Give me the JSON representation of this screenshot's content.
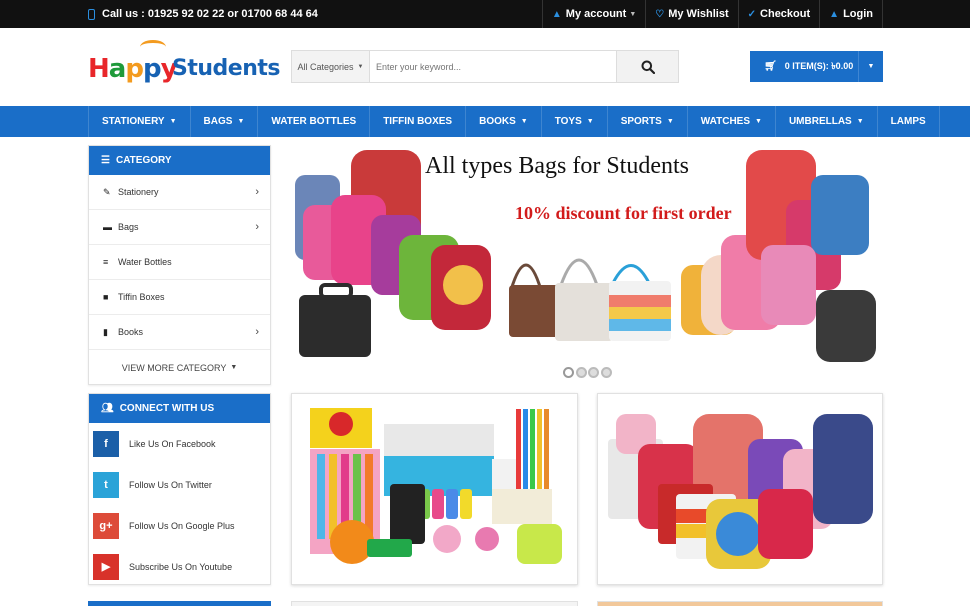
{
  "topbar": {
    "phone": "Call us : 01925 92 02 22 or 01700 68 44 64",
    "account": "My account",
    "wishlist": "My Wishlist",
    "checkout": "Checkout",
    "login": "Login"
  },
  "logo": {
    "word1": "Happy",
    "word2": "Students"
  },
  "search": {
    "category": "All Categories",
    "placeholder": "Enter your keyword..."
  },
  "cart": {
    "label": "0 ITEM(S): ৳0.00"
  },
  "nav": [
    {
      "label": "STATIONERY",
      "dropdown": true
    },
    {
      "label": "BAGS",
      "dropdown": true
    },
    {
      "label": "WATER BOTTLES",
      "dropdown": false
    },
    {
      "label": "TIFFIN BOXES",
      "dropdown": false
    },
    {
      "label": "BOOKS",
      "dropdown": true
    },
    {
      "label": "TOYS",
      "dropdown": true
    },
    {
      "label": "SPORTS",
      "dropdown": true
    },
    {
      "label": "WATCHES",
      "dropdown": true
    },
    {
      "label": "UMBRELLAS",
      "dropdown": true
    },
    {
      "label": "LAMPS",
      "dropdown": false
    }
  ],
  "category": {
    "heading": "CATEGORY",
    "items": [
      {
        "label": "Stationery",
        "icon": "pencil-icon",
        "arrow": true
      },
      {
        "label": "Bags",
        "icon": "briefcase-icon",
        "arrow": true
      },
      {
        "label": "Water Bottles",
        "icon": "database-icon",
        "arrow": false
      },
      {
        "label": "Tiffin Boxes",
        "icon": "archive-icon",
        "arrow": false
      },
      {
        "label": "Books",
        "icon": "book-icon",
        "arrow": true
      }
    ],
    "more": "VIEW MORE CATEGORY"
  },
  "connect": {
    "heading": "CONNECT WITH US",
    "items": [
      {
        "label": "Like Us On Facebook",
        "icon": "facebook-icon",
        "glyph": "f",
        "color": "#1b5fa8"
      },
      {
        "label": "Follow Us On Twitter",
        "icon": "twitter-icon",
        "glyph": "t",
        "color": "#2aa3d8"
      },
      {
        "label": "Follow Us On Google Plus",
        "icon": "google-plus-icon",
        "glyph": "g+",
        "color": "#dd4b39"
      },
      {
        "label": "Subscribe Us On Youtube",
        "icon": "youtube-icon",
        "glyph": "▶",
        "color": "#d8322a"
      }
    ]
  },
  "banner": {
    "title": "All types Bags for Students",
    "discount": "10% discount for first order",
    "slides": 4,
    "active_slide": 1
  },
  "colors": {
    "primary": "#1a6ec8",
    "topbar": "#111111",
    "discount": "#d21b1b"
  }
}
